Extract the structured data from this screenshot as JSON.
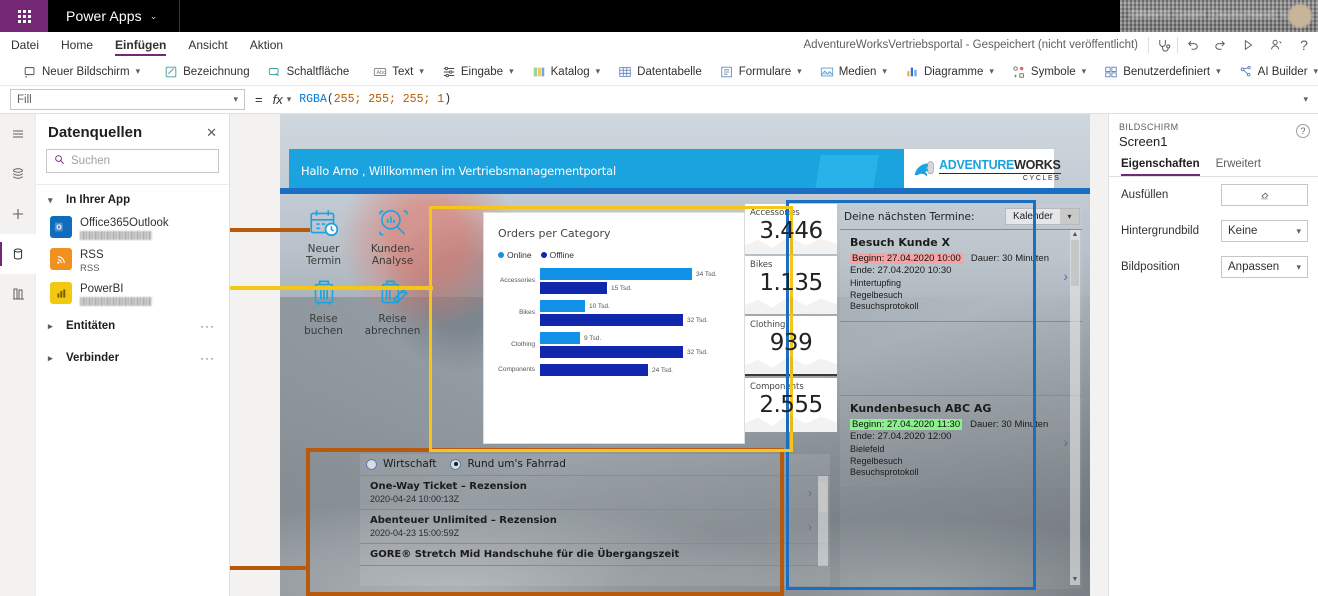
{
  "topbar": {
    "brand": "Power Apps",
    "waffle_icon": "app-launcher-icon",
    "brand_caret": "⌄",
    "user_text": "GRAVIS GmbH (Deutschland) Ic..."
  },
  "menu": {
    "items": [
      "Datei",
      "Home",
      "Einfügen",
      "Ansicht",
      "Aktion"
    ],
    "active": "Einfügen",
    "save_status": "AdventureWorksVertriebsportal - Gespeichert (nicht veröffentlicht)",
    "icons": [
      "stethoscope-icon",
      "undo-icon",
      "redo-icon",
      "play-icon",
      "share-user-icon",
      "help-icon"
    ]
  },
  "ribbon": {
    "items": [
      {
        "label": "Neuer Bildschirm",
        "icon": "new-screen-icon",
        "caret": true
      },
      {
        "label": "Bezeichnung",
        "icon": "label-icon",
        "caret": false
      },
      {
        "label": "Schaltfläche",
        "icon": "button-icon",
        "caret": false
      },
      {
        "label": "Text",
        "icon": "text-icon",
        "caret": true
      },
      {
        "label": "Eingabe",
        "icon": "input-icon",
        "caret": true
      },
      {
        "label": "Katalog",
        "icon": "gallery-icon",
        "caret": true
      },
      {
        "label": "Datentabelle",
        "icon": "data-table-icon",
        "caret": false
      },
      {
        "label": "Formulare",
        "icon": "forms-icon",
        "caret": true
      },
      {
        "label": "Medien",
        "icon": "media-icon",
        "caret": true
      },
      {
        "label": "Diagramme",
        "icon": "charts-icon",
        "caret": true
      },
      {
        "label": "Symbole",
        "icon": "icons-icon",
        "caret": true
      },
      {
        "label": "Benutzerdefiniert",
        "icon": "custom-icon",
        "caret": true
      },
      {
        "label": "AI Builder",
        "icon": "ai-builder-icon",
        "caret": true
      }
    ]
  },
  "formula_bar": {
    "property": "Fill",
    "equals": "=",
    "fx": "fx",
    "formula_fn": "RGBA",
    "formula_args": "255; 255; 255; 1",
    "formula_full": "RGBA(255; 255; 255; 1)"
  },
  "rail": {
    "items": [
      {
        "name": "hamburger-menu-icon"
      },
      {
        "name": "tree-view-icon"
      },
      {
        "name": "insert-plus-icon"
      },
      {
        "name": "data-sources-icon",
        "selected": true
      },
      {
        "name": "media-library-icon"
      }
    ]
  },
  "data_panel": {
    "title": "Datenquellen",
    "close_icon": "close-icon",
    "search_placeholder": "Suchen",
    "search_icon": "search-icon",
    "group_label": "In Ihrer App",
    "sources": [
      {
        "name": "Office365Outlook",
        "sub": "",
        "blurred": true,
        "icon": "outlook-icon"
      },
      {
        "name": "RSS",
        "sub": "RSS",
        "blurred": false,
        "icon": "rss-icon"
      },
      {
        "name": "PowerBI",
        "sub": "",
        "blurred": true,
        "icon": "powerbi-icon"
      }
    ],
    "rows": [
      {
        "label": "Entitäten",
        "dots": "···"
      },
      {
        "label": "Verbinder",
        "dots": "···"
      }
    ]
  },
  "screen": {
    "banner_text": "Hallo Arno , Willkommen im Vertriebsmanagementportal",
    "logo": {
      "part_a": "ADVENTURE",
      "part_b": "WORKS",
      "sub": "CYCLES",
      "icon": "adventureworks-bird-icon"
    },
    "tiles": [
      {
        "label": "Neuer\nTermin",
        "line1": "Neuer",
        "line2": "Termin",
        "icon": "calendar-clock-icon"
      },
      {
        "label": "Kunden-\nAnalyse",
        "line1": "Kunden-",
        "line2": "Analyse",
        "icon": "analytics-search-icon"
      },
      {
        "label": "Reise\nbuchen",
        "line1": "Reise",
        "line2": "buchen",
        "icon": "suitcase-icon"
      },
      {
        "label": "Reise\nabrechnen",
        "line1": "Reise",
        "line2": "abrechnen",
        "icon": "suitcase-tag-icon"
      }
    ]
  },
  "chart_data": {
    "type": "bar",
    "title": "Orders per Category",
    "orientation": "horizontal",
    "categories": [
      "Accessories",
      "Bikes",
      "Clothing",
      "Components"
    ],
    "legend": [
      {
        "name": "Online",
        "color": "#1192e8"
      },
      {
        "name": "Offline",
        "color": "#1027ad"
      }
    ],
    "legend_position": "top-left",
    "series": [
      {
        "name": "Online",
        "color": "#1192e8",
        "values": [
          34,
          10,
          9,
          0
        ],
        "labels": [
          "34 Tsd.",
          "10 Tsd.",
          "9 Tsd.",
          ""
        ]
      },
      {
        "name": "Offline",
        "color": "#1027ad",
        "values": [
          15,
          32,
          32,
          24
        ],
        "labels": [
          "15 Tsd.",
          "32 Tsd.",
          "32 Tsd.",
          "24 Tsd."
        ]
      }
    ],
    "unit": "Tsd.",
    "xlabel": "",
    "ylabel": "",
    "xlim": [
      0,
      36
    ],
    "grid": false
  },
  "kpis": [
    {
      "label": "Accessories",
      "value": "3.446"
    },
    {
      "label": "Bikes",
      "value": "1.135"
    },
    {
      "label": "Clothing",
      "value": "939"
    },
    {
      "label": "Components",
      "value": "2.555"
    }
  ],
  "calendar": {
    "header": "Deine nächsten Termine:",
    "dropdown_value": "Kalender",
    "dropdown_caret": "⌄",
    "events": [
      {
        "title": "Besuch Kunde X",
        "start_label": "Beginn: 27.04.2020 10:00",
        "highlight": "red",
        "duration": "Dauer: 30 Minuten",
        "end_label": "Ende:   27.04.2020 10:30",
        "meta": [
          "Hintertupfing",
          "Regelbesuch",
          "Besuchsprotokoll"
        ],
        "arrow": "›"
      },
      {
        "title": "Kundenbesuch ABC AG",
        "start_label": "Beginn: 27.04.2020 11:30",
        "highlight": "green",
        "duration": "Dauer: 30 Minuten",
        "end_label": "Ende:   27.04.2020 12:00",
        "meta": [
          "Bielefeld",
          "Regelbesuch",
          "Besuchsprotokoll"
        ],
        "arrow": "›"
      }
    ]
  },
  "news": {
    "radios": [
      {
        "label": "Wirtschaft",
        "selected": false
      },
      {
        "label": "Rund um's Fahrrad",
        "selected": true
      }
    ],
    "items": [
      {
        "title": "One-Way Ticket – Rezension",
        "date": "2020-04-24 10:00:13Z",
        "arrow": "›"
      },
      {
        "title": "Abenteuer Unlimited – Rezension",
        "date": "2020-04-23 15:00:59Z",
        "arrow": "›"
      },
      {
        "title": "GORE® Stretch Mid Handschuhe für die Übergangszeit",
        "date": "",
        "arrow": ""
      }
    ]
  },
  "properties": {
    "kind": "BILDSCHIRM",
    "name": "Screen1",
    "help_icon": "help-circle-icon",
    "tabs": [
      {
        "label": "Eigenschaften",
        "active": true
      },
      {
        "label": "Erweitert",
        "active": false
      }
    ],
    "rows": [
      {
        "label": "Ausfüllen",
        "value": "",
        "type": "color",
        "icon": "color-swatch-icon"
      },
      {
        "label": "Hintergrundbild",
        "value": "Keine",
        "type": "select"
      },
      {
        "label": "Bildposition",
        "value": "Anpassen",
        "type": "select"
      }
    ]
  },
  "colors": {
    "brand_purple": "#742774",
    "accent_blue": "#1aa3de",
    "anno_blue": "#1b6fc2",
    "anno_orange": "#b85a0d",
    "anno_yellow": "#f5c518",
    "bar_online": "#1192e8",
    "bar_offline": "#1027ad",
    "highlight_red": "#f6a3a3",
    "highlight_green": "#8cf08c"
  }
}
